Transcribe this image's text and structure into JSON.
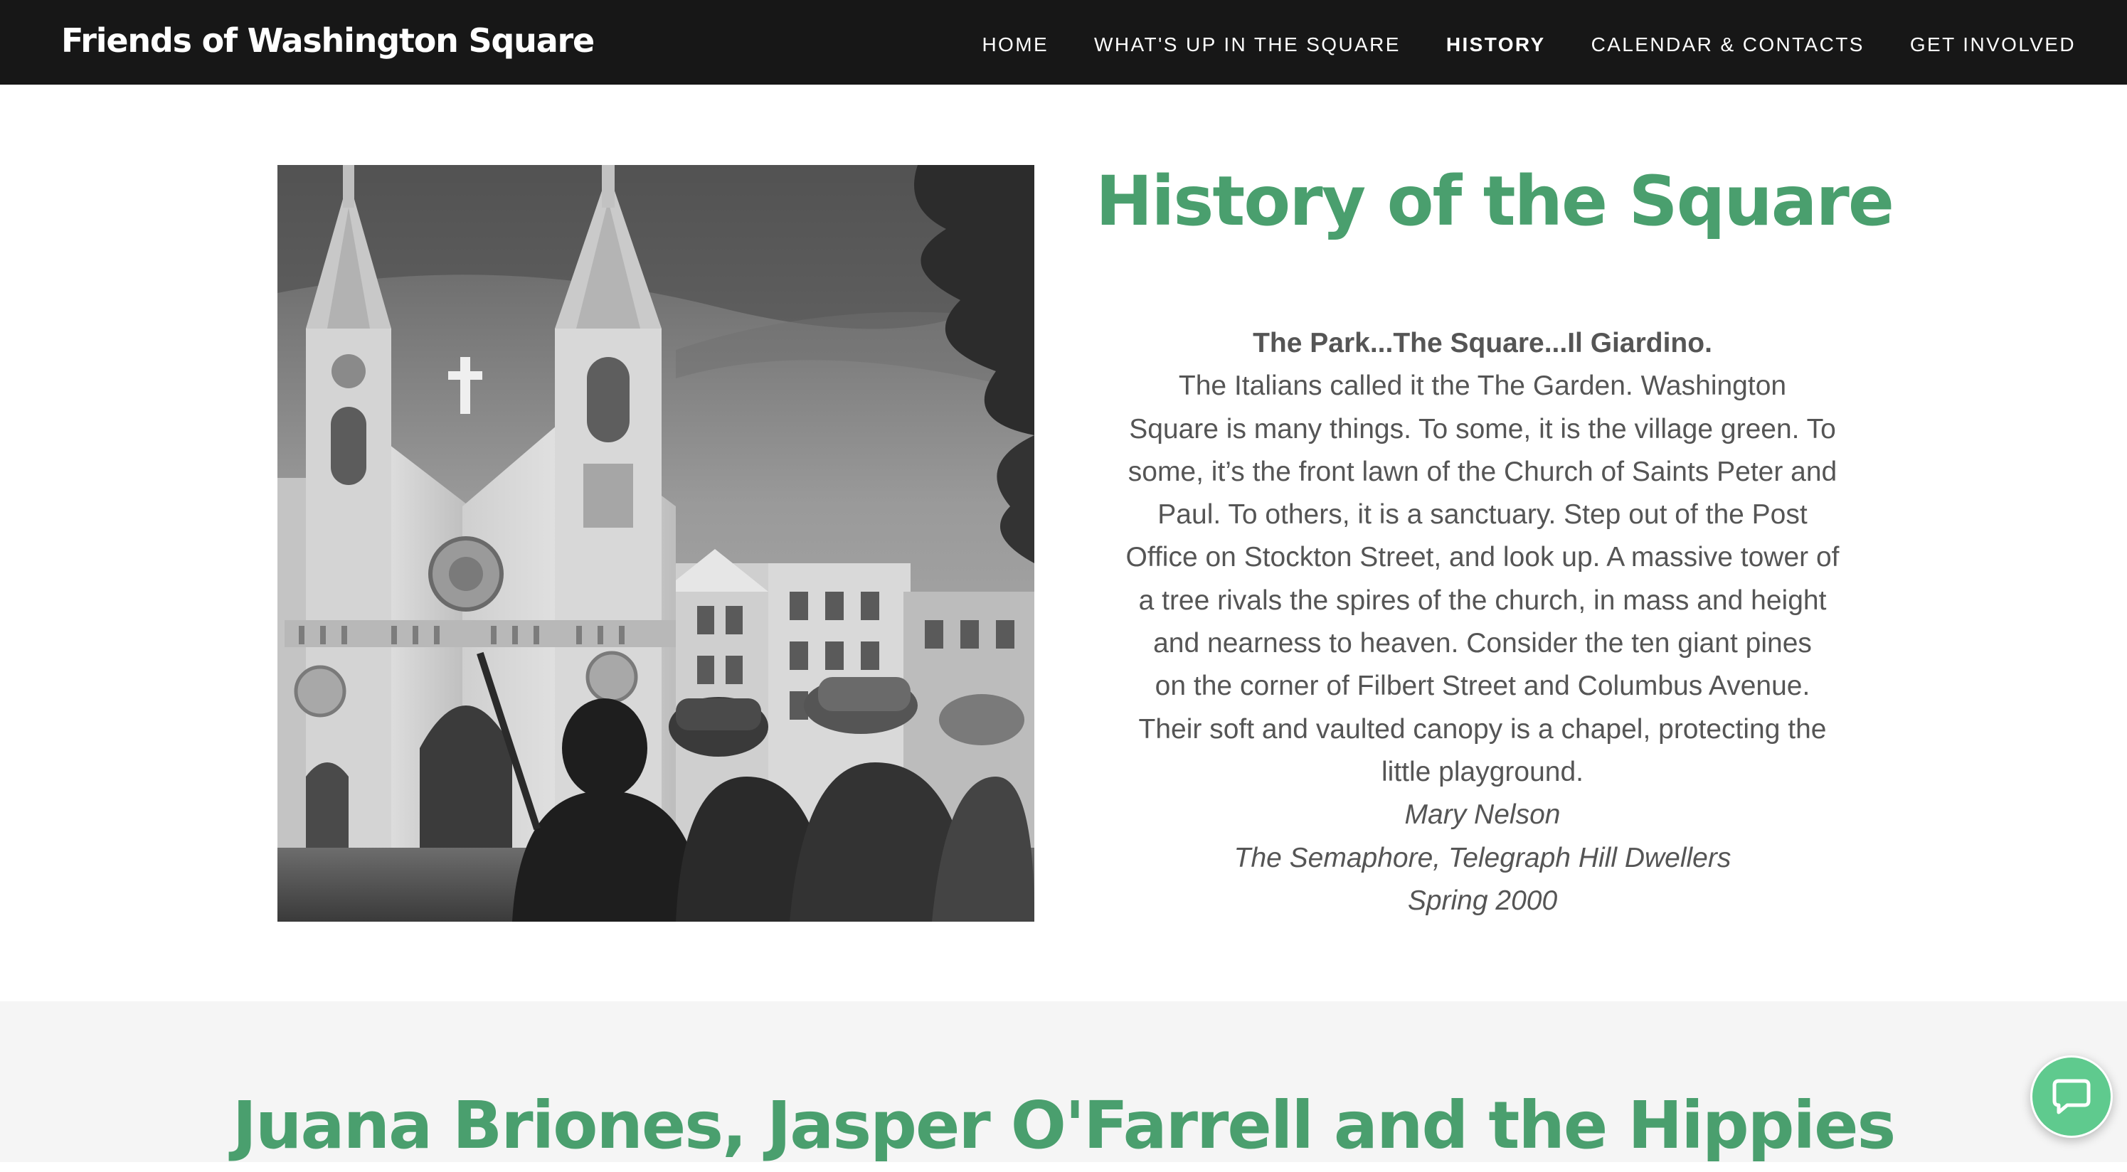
{
  "header": {
    "site_title": "Friends of Washington Square",
    "nav": [
      {
        "label": "HOME",
        "active": false
      },
      {
        "label": "WHAT'S UP IN THE SQUARE",
        "active": false
      },
      {
        "label": "HISTORY",
        "active": true
      },
      {
        "label": "CALENDAR & CONTACTS",
        "active": false
      },
      {
        "label": "GET INVOLVED",
        "active": false
      }
    ]
  },
  "history": {
    "title": "History of the Square",
    "quote_heading": "The Park...The Square...Il Giardino.",
    "quote_lines": [
      "The Italians called it the The Garden.  Washington",
      "Square is many things.  To some, it is the village green. To",
      "some, it’s the front lawn of the Church of Saints Peter and",
      "Paul.  To others, it is a sanctuary.  Step out of the Post",
      "Office on Stockton Street, and look up.  A massive tower of",
      "a tree rivals the spires of the church, in mass and height",
      "and nearness to heaven.  Consider the ten giant pines",
      "on the corner of Filbert Street and Columbus Avenue.",
      "Their soft and vaulted canopy is a chapel, protecting the",
      "little playground."
    ],
    "attribution": {
      "author": "Mary Nelson",
      "publication": "The Semaphore, Telegraph Hill Dwellers",
      "date": "Spring 2000"
    }
  },
  "section2": {
    "title": "Juana Briones, Jasper O'Farrell and the Hippies"
  },
  "chat": {
    "icon": "chat-bubble-icon"
  },
  "colors": {
    "header_bg": "#171717",
    "accent_green": "#4a9f6e",
    "body_text": "#555555",
    "section_bg": "#f5f5f5",
    "chat_green": "#5fca8e"
  }
}
